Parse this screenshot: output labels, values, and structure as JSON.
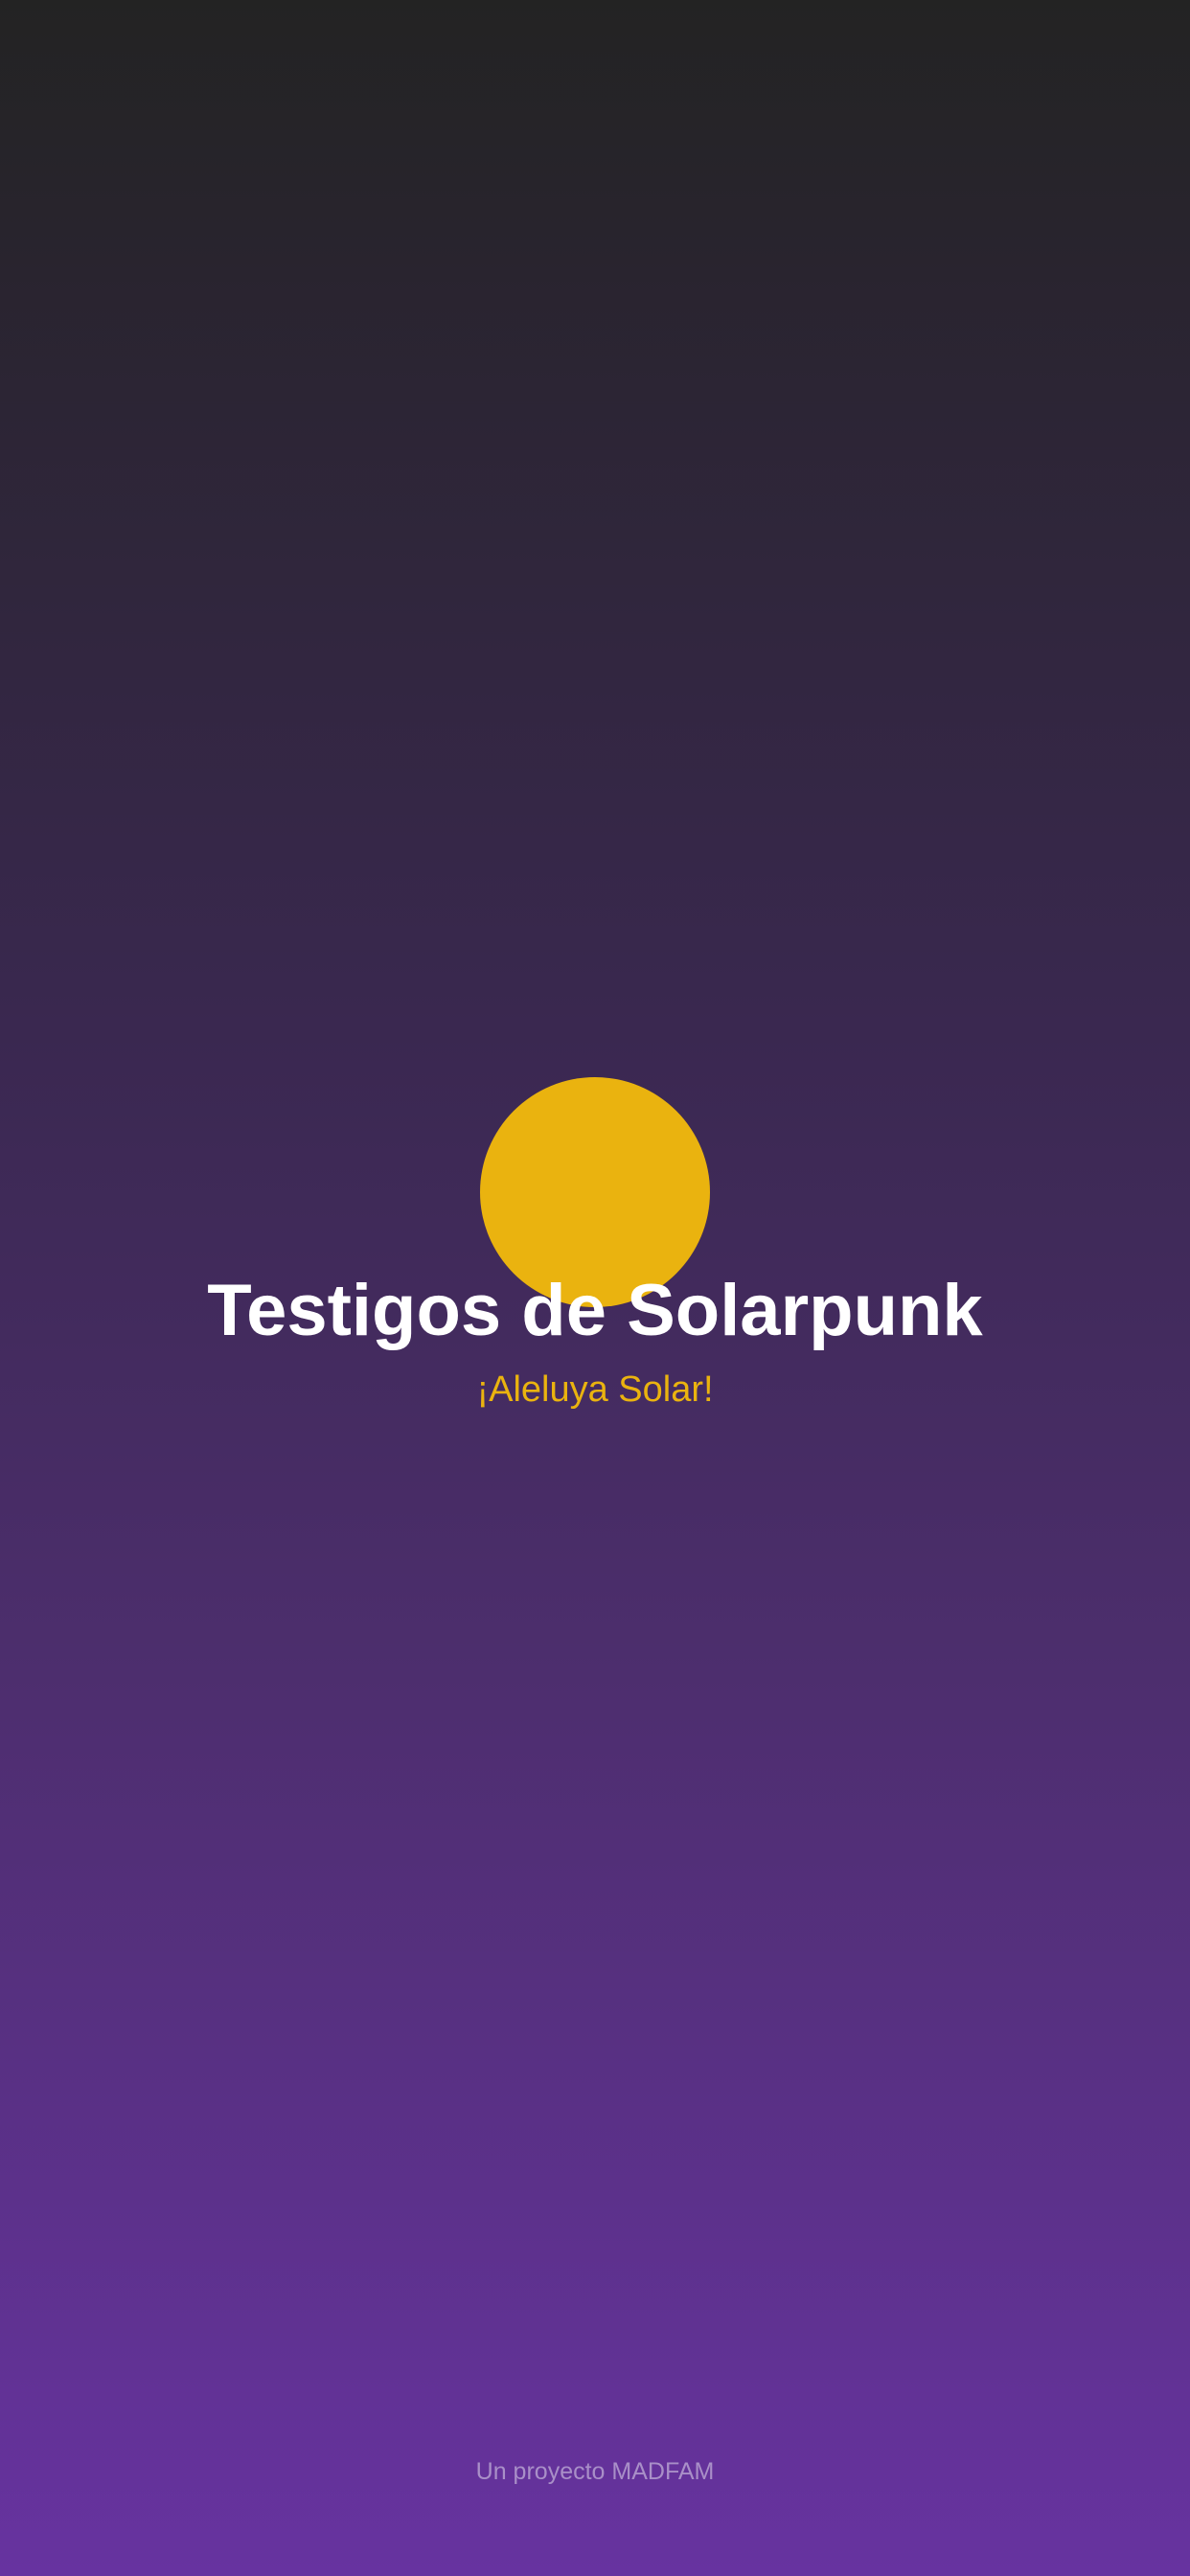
{
  "splash": {
    "logo_icon": "sun-icon",
    "logo_color": "#eab30f",
    "title": "Testigos de Solarpunk",
    "subtitle": "¡Aleluya Solar!",
    "footer": "Un proyecto MADFAM"
  },
  "colors": {
    "background_top": "#232323",
    "background_bottom": "#6733a0",
    "title": "#ffffff",
    "accent": "#eab30f",
    "footer": "#a98fc8"
  }
}
